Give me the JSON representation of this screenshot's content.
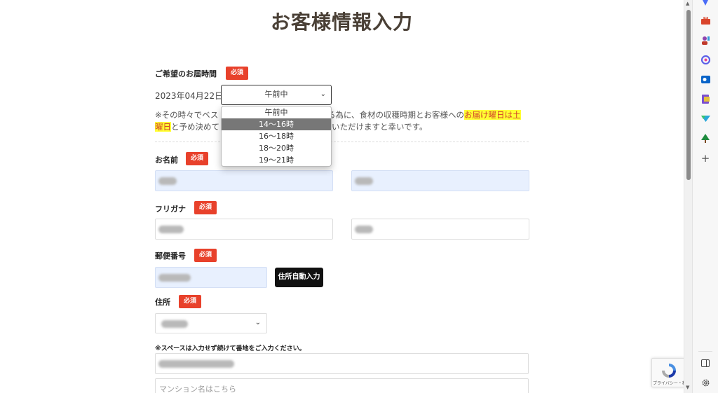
{
  "page": {
    "title": "お客様情報入力"
  },
  "delivery": {
    "label": "ご希望のお届時間",
    "required": "必須",
    "date": "2023年04月22日",
    "selected": "午前中",
    "options": [
      "午前中",
      "14〜16時",
      "16〜18時",
      "18〜20時",
      "19〜21時"
    ],
    "highlighted_index": 1,
    "note_prefix": "※その時々でベス",
    "note_mid1": "する為に、食材の収穫時期とお客様への",
    "note_highlight1": "お届け曜日は土",
    "note_highlight2": "曜日",
    "note_mid2": "と予め決めて",
    "note_suffix": "いただけますと幸いです。"
  },
  "name": {
    "label": "お名前",
    "required": "必須"
  },
  "furigana": {
    "label": "フリガナ",
    "required": "必須"
  },
  "postal": {
    "label": "郵便番号",
    "required": "必須",
    "auto_button": "住所自動入力"
  },
  "address": {
    "label": "住所",
    "required": "必須",
    "note": "※スペースは入力せず続けて番地をご入力ください。",
    "building_placeholder": "マンション名はこちら"
  },
  "recaptcha": {
    "text": "プライバシー・利用規約"
  },
  "colors": {
    "accent_red": "#e8412b",
    "title": "#4a4036",
    "highlight": "#ffff33"
  },
  "sidebar_icons": [
    "favorites-icon",
    "toolbox-icon",
    "people-icon",
    "copilot-icon",
    "outlook-icon",
    "office-icon",
    "games-icon",
    "tree-icon",
    "add-icon",
    "split-view-icon",
    "settings-icon"
  ]
}
